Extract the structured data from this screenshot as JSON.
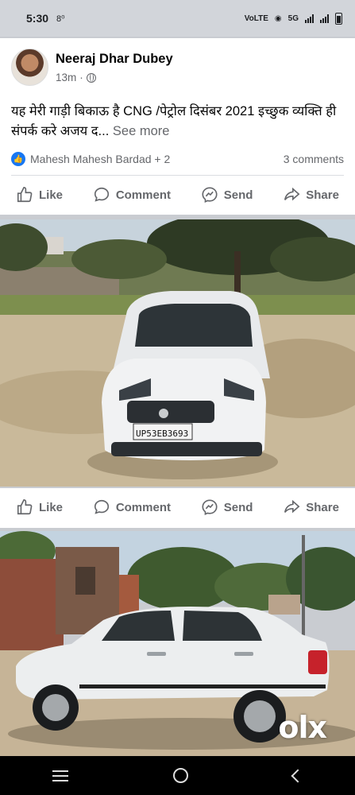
{
  "status_bar": {
    "time": "5:30",
    "notification_icon": "sync-icon",
    "network_label": "VoLTE",
    "network_type": "5G"
  },
  "post": {
    "author": "Neeraj Dhar Dubey",
    "time_ago": "13m",
    "privacy_icon": "globe-icon",
    "text": "यह मेरी गाड़ी बिकाऊ है CNG /पेट्रोल दिसंबर 2021 इच्छुक व्यक्ति ही संपर्क करे अजय द...",
    "see_more": "See more",
    "reactors": "Mahesh Mahesh Bardad + 2",
    "comments": "3 comments"
  },
  "actions": {
    "like": "Like",
    "comment": "Comment",
    "send": "Send",
    "share": "Share"
  },
  "photos": {
    "plate": "UP53EB3693",
    "watermark": "olx"
  },
  "colors": {
    "accent": "#1877f2",
    "muted_text": "#65676b"
  }
}
